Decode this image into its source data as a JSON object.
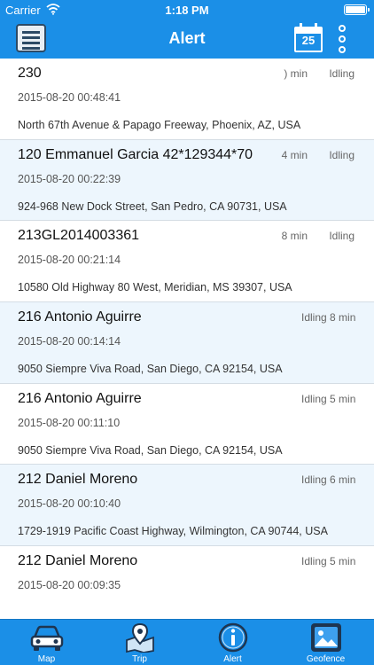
{
  "status_bar": {
    "carrier": "Carrier",
    "time": "1:18 PM"
  },
  "header": {
    "title": "Alert",
    "calendar_day": "25"
  },
  "alerts": [
    {
      "name": "230",
      "duration": ") min",
      "status": "Idling",
      "timestamp": "2015-08-20 00:48:41",
      "address": "North 67th Avenue & Papago Freeway, Phoenix, AZ, USA"
    },
    {
      "name": "120 Emmanuel Garcia 42*129344*70",
      "duration": "4 min",
      "status": "Idling",
      "timestamp": "2015-08-20 00:22:39",
      "address": "924-968 New Dock Street, San Pedro, CA 90731, USA"
    },
    {
      "name": "213GL2014003361",
      "duration": "8 min",
      "status": "Idling",
      "timestamp": "2015-08-20 00:21:14",
      "address": "10580 Old Highway 80 West, Meridian, MS 39307, USA"
    },
    {
      "name": "216 Antonio Aguirre",
      "duration": "",
      "status": "Idling 8 min",
      "timestamp": "2015-08-20 00:14:14",
      "address": "9050 Siempre Viva Road, San Diego, CA 92154, USA"
    },
    {
      "name": "216 Antonio Aguirre",
      "duration": "",
      "status": "Idling 5 min",
      "timestamp": "2015-08-20 00:11:10",
      "address": "9050 Siempre Viva Road, San Diego, CA 92154, USA"
    },
    {
      "name": "212 Daniel Moreno",
      "duration": "",
      "status": "Idling 6 min",
      "timestamp": "2015-08-20 00:10:40",
      "address": "1729-1919 Pacific Coast Highway, Wilmington, CA 90744, USA"
    },
    {
      "name": "212 Daniel Moreno",
      "duration": "",
      "status": "Idling 5 min",
      "timestamp": "2015-08-20 00:09:35",
      "address": ""
    }
  ],
  "tabs": [
    {
      "label": "Map",
      "icon": "car-icon"
    },
    {
      "label": "Trip",
      "icon": "map-pin-icon"
    },
    {
      "label": "Alert",
      "icon": "info-icon"
    },
    {
      "label": "Geofence",
      "icon": "image-icon"
    }
  ],
  "colors": {
    "primary": "#1b8fe7",
    "row_alt": "#edf6fd",
    "divider": "#d5dde4"
  }
}
